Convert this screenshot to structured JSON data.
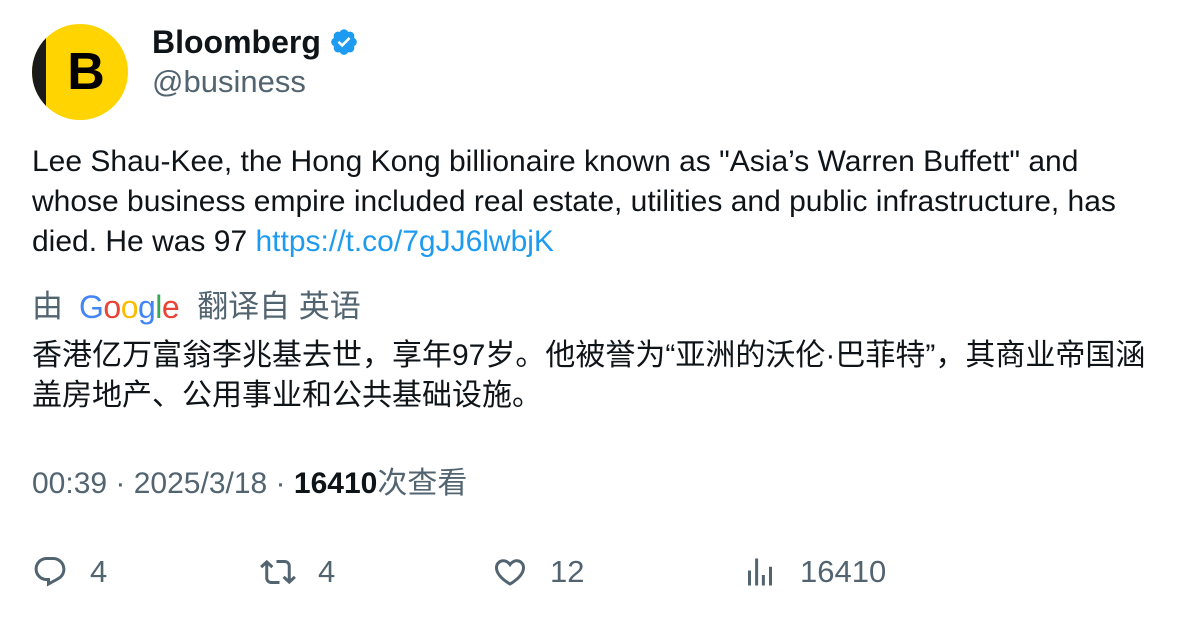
{
  "author": {
    "avatar_letter": "B",
    "name": "Bloomberg",
    "handle": "@business",
    "verified_color": "#1d9bf0"
  },
  "tweet": {
    "text": "Lee Shau-Kee, the Hong Kong billionaire known as \"Asia’s Warren Buffett\" and whose business empire included real estate, utilities and public infrastructure, has died. He was 97 ",
    "link": "https://t.co/7gJJ6lwbjK"
  },
  "translation": {
    "by_label": "由",
    "google": [
      "G",
      "o",
      "o",
      "g",
      "l",
      "e"
    ],
    "from_label": "翻译自 英语",
    "text": "香港亿万富翁李兆基去世，享年97岁。他被誉为“亚洲的沃伦·巴菲特”，其商业帝国涵盖房地产、公用事业和公共基础设施。"
  },
  "meta": {
    "time": "00:39",
    "sep": " · ",
    "date": "2025/3/18",
    "views": "16410",
    "views_label": "次查看"
  },
  "actions": {
    "reply_count": "4",
    "retweet_count": "4",
    "like_count": "12",
    "view_count": "16410"
  },
  "colors": {
    "link": "#1d9bf0",
    "secondary": "#536471",
    "avatar_bg": "#ffd400"
  },
  "icons": [
    "verified-badge-icon",
    "reply-icon",
    "retweet-icon",
    "like-icon",
    "views-icon"
  ]
}
